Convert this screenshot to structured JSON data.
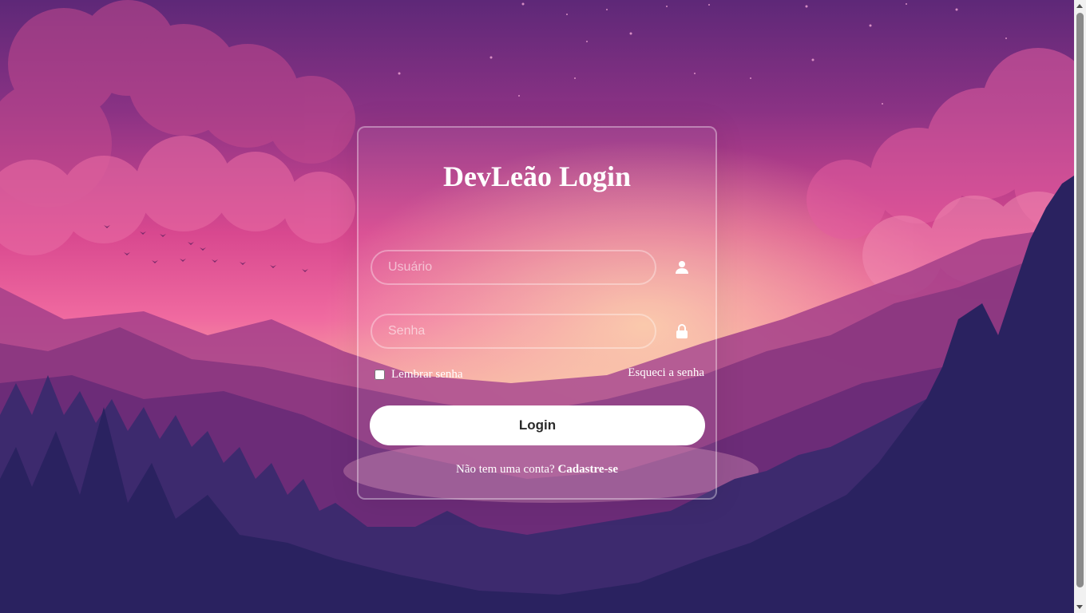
{
  "login": {
    "title": "DevLeão Login",
    "username_placeholder": "Usuário",
    "password_placeholder": "Senha",
    "remember_label": "Lembrar senha",
    "forgot_label": "Esqueci a senha",
    "submit_label": "Login",
    "register_prompt": "Não tem uma conta?",
    "register_link": "Cadastre-se"
  },
  "icons": {
    "username": "user-icon",
    "password": "lock-icon"
  },
  "colors": {
    "sky_top": "#6a2a7a",
    "sky_mid": "#e2559a",
    "horizon": "#f7a4a0",
    "forest": "#2a2260",
    "button": "#ffffff",
    "text": "#ffffff"
  }
}
